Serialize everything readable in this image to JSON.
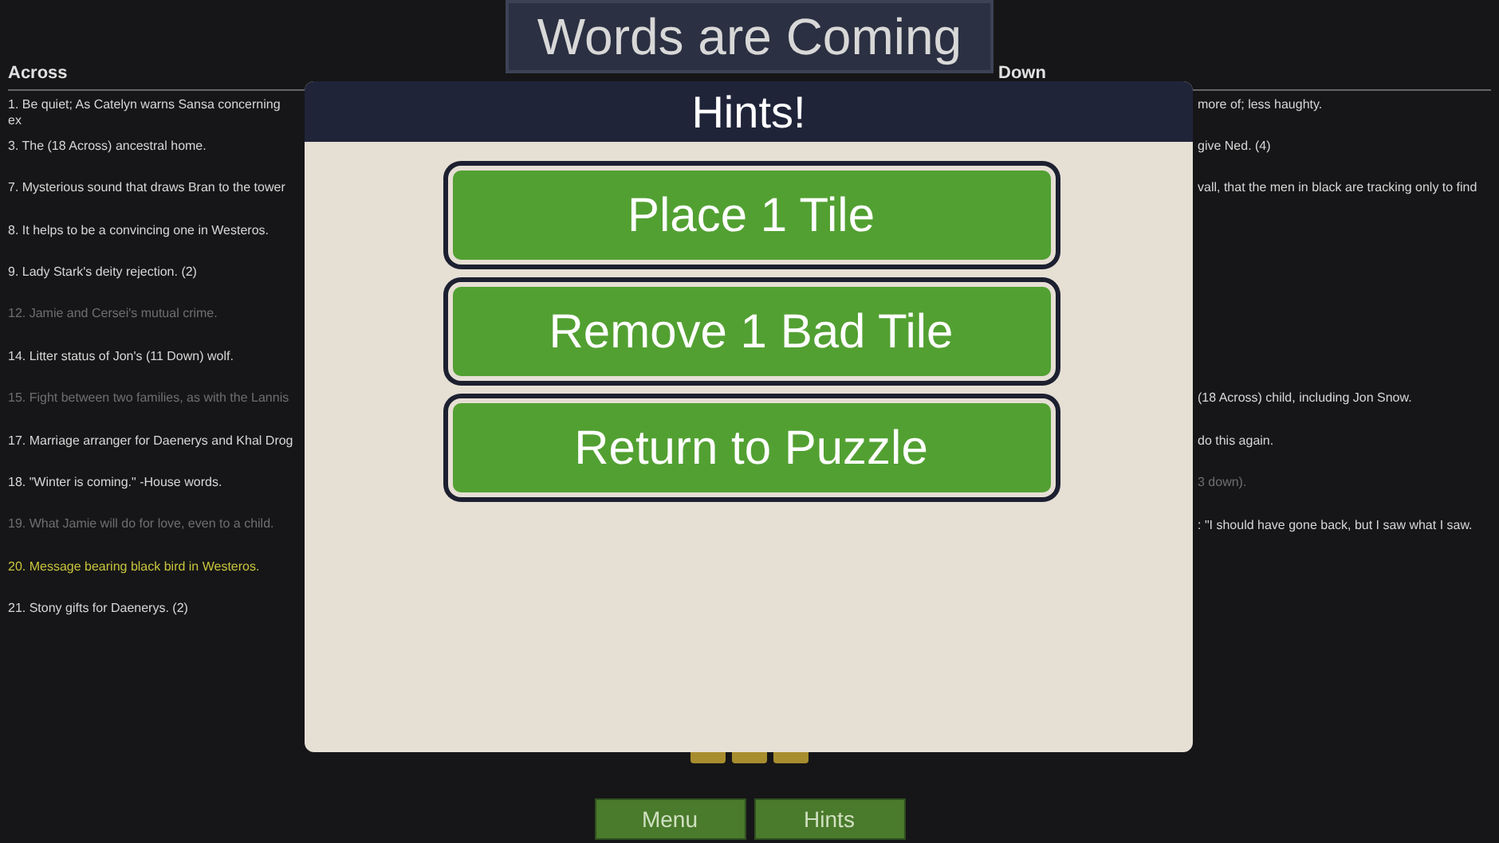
{
  "title": "Words are Coming",
  "across": {
    "heading": "Across",
    "clues": [
      {
        "text": "1.  Be quiet; As Catelyn warns Sansa concerning ex",
        "solved": false,
        "selected": false
      },
      {
        "text": "3.  The (18 Across) ancestral home.",
        "solved": false,
        "selected": false
      },
      {
        "text": "7.  Mysterious sound that draws Bran to the tower",
        "solved": false,
        "selected": false
      },
      {
        "text": "8.  It helps to be a convincing one in Westeros.",
        "solved": false,
        "selected": false
      },
      {
        "text": "9.  Lady Stark's deity rejection. (2)",
        "solved": false,
        "selected": false
      },
      {
        "text": "12.  Jamie and Cersei's mutual crime.",
        "solved": true,
        "selected": false
      },
      {
        "text": "14.  Litter status of Jon's (11 Down) wolf.",
        "solved": false,
        "selected": false
      },
      {
        "text": "15.  Fight between two families, as with the Lannis",
        "solved": true,
        "selected": false
      },
      {
        "text": "17.  Marriage arranger for Daenerys and Khal Drog",
        "solved": false,
        "selected": false
      },
      {
        "text": "18.  \"Winter is coming.\" -House words.",
        "solved": false,
        "selected": false
      },
      {
        "text": "19.  What Jamie will do for love, even to a child.",
        "solved": true,
        "selected": false
      },
      {
        "text": "20.  Message bearing black bird in Westeros.",
        "solved": false,
        "selected": true
      },
      {
        "text": "21.  Stony gifts for Daenerys. (2)",
        "solved": false,
        "selected": false
      }
    ]
  },
  "down": {
    "heading": "Down",
    "clues": [
      {
        "text": "more of; less haughty.",
        "solved": false
      },
      {
        "text": "give Ned. (4)",
        "solved": false
      },
      {
        "text": "vall, that the men in black are tracking only to find",
        "solved": false
      },
      {
        "text": "(18 Across) child, including Jon Snow.",
        "solved": false
      },
      {
        "text": "do this again.",
        "solved": false
      },
      {
        "text": "3 down).",
        "solved": true
      },
      {
        "text": ": \"I should have gone back, but I saw what I saw.",
        "solved": false
      }
    ]
  },
  "dialog": {
    "title": "Hints!",
    "buttons": [
      "Place 1 Tile",
      "Remove 1 Bad Tile",
      "Return to Puzzle"
    ]
  },
  "footer_buttons": [
    "Menu",
    "Hints"
  ]
}
